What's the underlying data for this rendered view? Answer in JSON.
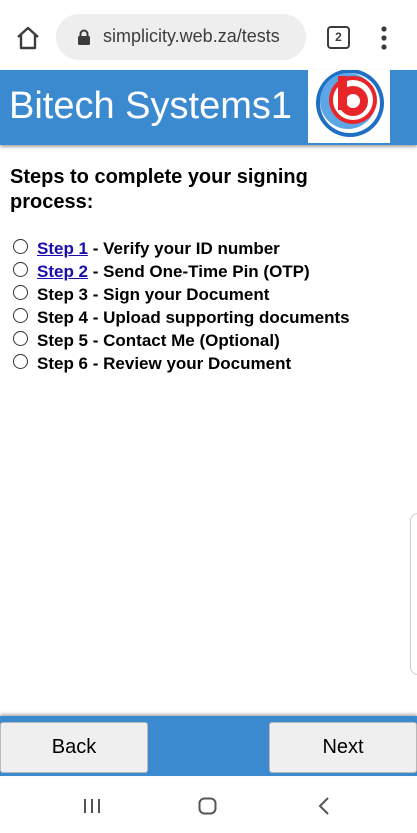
{
  "browser": {
    "url": "simplicity.web.za/tests",
    "tab_count": "2"
  },
  "site": {
    "title": "Bitech Systems1",
    "logo_text": "b",
    "colors": {
      "header": "#3b8ad0",
      "logo_red": "#e8262a",
      "logo_blue": "#1f6fc4"
    }
  },
  "content": {
    "title": "Steps to complete your signing process:",
    "steps": [
      {
        "name": "Step 1",
        "desc": " - Verify your ID number",
        "linked": true
      },
      {
        "name": "Step 2",
        "desc": " - Send One-Time Pin (OTP)",
        "linked": true
      },
      {
        "name": "Step 3",
        "desc": " - Sign your Document",
        "linked": false
      },
      {
        "name": "Step 4",
        "desc": " - Upload supporting documents",
        "linked": false
      },
      {
        "name": "Step 5",
        "desc": " - Contact Me (Optional)",
        "linked": false
      },
      {
        "name": "Step 6",
        "desc": " - Review your Document",
        "linked": false
      }
    ]
  },
  "footer": {
    "back_label": "Back",
    "next_label": "Next"
  },
  "icons": [
    "home-icon",
    "lock-icon",
    "tabs-icon",
    "more-vert-icon",
    "recents-icon",
    "android-home-icon",
    "android-back-icon"
  ]
}
